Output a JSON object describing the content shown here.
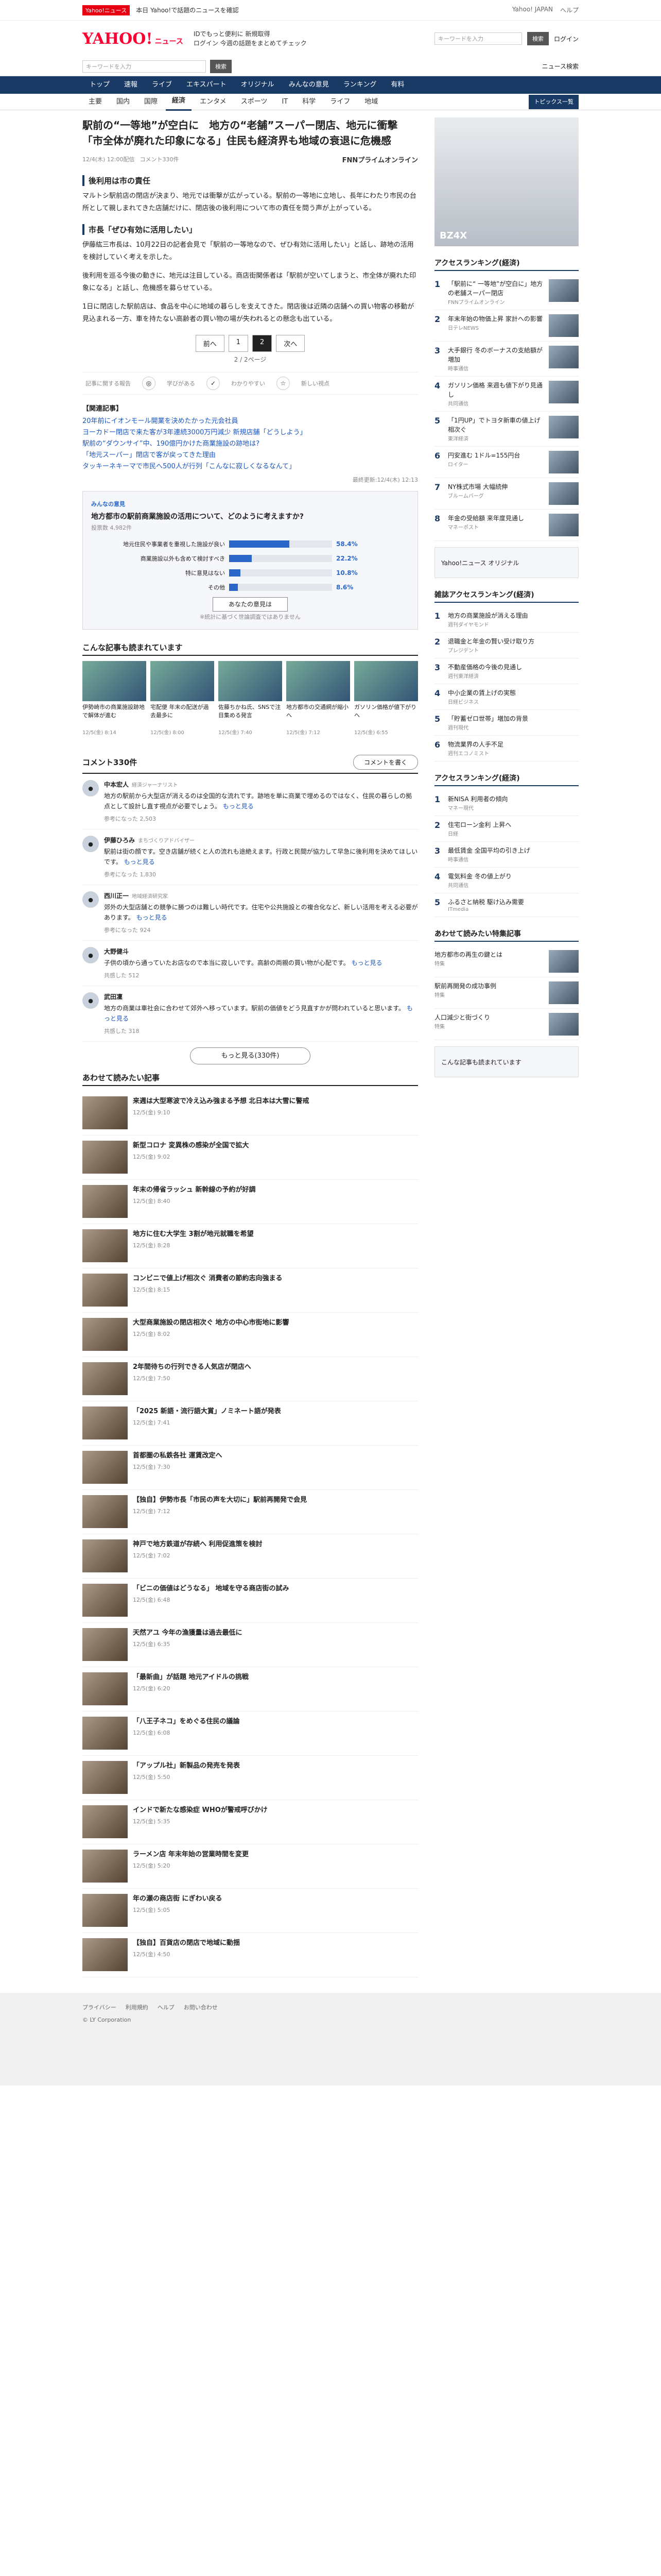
{
  "topbar": {
    "tag": "Yahoo!ニュース",
    "text": "本日 Yahoo!で話題のニュースを確認",
    "links": [
      "Yahoo! JAPAN",
      "ヘルプ"
    ]
  },
  "header": {
    "brand": "YAHOO!",
    "brand_sub": "ニュース",
    "line1": "IDでもっと便利に 新規取得",
    "line2": "ログイン 今週の話題をまとめてチェック",
    "search_placeholder": "キーワードを入力",
    "search_button": "検索",
    "login": "ログイン"
  },
  "search": {
    "placeholder": "キーワードを入力",
    "button": "検索",
    "right": "ニュース検索"
  },
  "nav": [
    "トップ",
    "速報",
    "ライブ",
    "エキスパート",
    "オリジナル",
    "みんなの意見",
    "ランキング",
    "有料"
  ],
  "subnav": {
    "items": [
      "主要",
      "国内",
      "国際",
      "経済",
      "エンタメ",
      "スポーツ",
      "IT",
      "科学",
      "ライフ",
      "地域"
    ],
    "active": "経済",
    "topics": "トピックス一覧"
  },
  "article": {
    "title": "駅前の“一等地”が空白に　地方の“老舗”スーパー閉店、地元に衝撃「市全体が廃れた印象になる」住民も経済界も地域の衰退に危機感",
    "date": "12/4(木) 12:00配信",
    "comments": "コメント330件",
    "source": "FNNプライムオンライン",
    "h_1": "後利用は市の責任",
    "p_1": "マルトシ駅前店の閉店が決まり、地元では衝撃が広がっている。駅前の一等地に立地し、長年にわたり市民の台所として親しまれてきた店舗だけに、閉店後の後利用について市の責任を問う声が上がっている。",
    "h_2": "市長「ぜひ有効に活用したい」",
    "p_2": "伊藤紘三市長は、10月22日の記者会見で「駅前の一等地なので、ぜひ有効に活用したい」と話し、跡地の活用を検討していく考えを示した。",
    "p_3": "後利用を巡る今後の動きに、地元は注目している。商店街関係者は「駅前が空いてしまうと、市全体が廃れた印象になる」と話し、危機感を募らせている。",
    "p_4": "1日に閉店した駅前店は、食品を中心に地域の暮らしを支えてきた。閉店後は近隣の店舗への買い物客の移動が見込まれる一方、車を持たない高齢者の買い物の場が失われるとの懸念も出ている。",
    "pager": {
      "prev": "前へ",
      "pages": [
        "1",
        "2"
      ],
      "current": "2",
      "next": "次へ",
      "info": "2 / 2ページ"
    },
    "toolbar": {
      "label": "記事に関する報告",
      "items": [
        "学びがある",
        "わかりやすい",
        "新しい視点"
      ]
    },
    "related": {
      "head": "【関連記事】",
      "links": [
        "20年前にイオンモール開業を決めたかった元会社員",
        "ヨーカドー閉店で来た客が3年連続3000万円減少 新規店舗「どうしよう」",
        "駅前の“ダウンサイ”中、190億円かけた商業施設の跡地は?",
        "「地元スーパー」閉店で客が戻ってきた理由",
        "タッキーネキーマで市民へ500人が行列「こんなに寂しくなるなんて」"
      ]
    },
    "updated": "最終更新:12/4(木) 12:13"
  },
  "survey": {
    "badge": "みんなの意見",
    "question": "地方都市の駅前商業施設の活用について、どのように考えますか?",
    "count": "投票数 4,982件",
    "options": [
      {
        "label": "地元住民や事業者を重視した施設が良い",
        "pct": "58.4%"
      },
      {
        "label": "商業施設以外も含めて検討すべき",
        "pct": "22.2%"
      },
      {
        "label": "特に意見はない",
        "pct": "10.8%"
      },
      {
        "label": "その他",
        "pct": "8.6%"
      }
    ],
    "vote": "あなたの意見は",
    "note": "※統計に基づく世論調査ではありません"
  },
  "recommend": {
    "head": "こんな記事も読まれています",
    "cards": [
      {
        "t": "伊勢崎市の商業施設跡地で解体が進む",
        "d": "12/5(金) 8:14"
      },
      {
        "t": "宅配便 年末の配送が過去最多に",
        "d": "12/5(金) 8:00"
      },
      {
        "t": "佐藤ちかね氏、SNSで注目集める発言",
        "d": "12/5(金) 7:40"
      },
      {
        "t": "地方都市の交通網が縮小へ",
        "d": "12/5(金) 7:12"
      },
      {
        "t": "ガソリン価格が値下がりへ",
        "d": "12/5(金) 6:55"
      }
    ]
  },
  "comments": {
    "title": "コメント330件",
    "button": "コメントを書く",
    "items": [
      {
        "name": "中本宏人",
        "role": "経済ジャーナリスト",
        "text": "地方の駅前から大型店が消えるのは全国的な流れです。跡地を単に商業で埋めるのではなく、住民の暮らしの拠点として設計し直す視点が必要でしょう。",
        "more": "もっと見る",
        "likes": "参考になった 2,503"
      },
      {
        "name": "伊藤ひろみ",
        "role": "まちづくりアドバイザー",
        "text": "駅前は街の顔です。空き店舗が続くと人の流れも途絶えます。行政と民間が協力して早急に後利用を決めてほしいです。",
        "more": "もっと見る",
        "likes": "参考になった 1,830"
      },
      {
        "name": "西川正一",
        "role": "地域経済研究家",
        "text": "郊外の大型店舗との競争に勝つのは難しい時代です。住宅や公共施設との複合化など、新しい活用を考える必要があります。",
        "more": "もっと見る",
        "likes": "参考になった 924"
      },
      {
        "name": "大野健斗",
        "role": "",
        "text": "子供の頃から通っていたお店なので本当に寂しいです。高齢の両親の買い物が心配です。",
        "more": "もっと見る",
        "likes": "共感した 512"
      },
      {
        "name": "武田凜",
        "role": "",
        "text": "地方の商業は車社会に合わせて郊外へ移っています。駅前の価値をどう見直すかが問われていると思います。",
        "more": "もっと見る",
        "likes": "共感した 318"
      }
    ],
    "more": "もっと見る(330件)"
  },
  "also": {
    "head": "あわせて読みたい記事",
    "items": [
      {
        "t": "来週は大型寒波で冷え込み強まる予想 北日本は大雪に警戒",
        "d": "12/5(金) 9:10"
      },
      {
        "t": "新型コロナ 変異株の感染が全国で拡大",
        "d": "12/5(金) 9:02"
      },
      {
        "t": "年末の帰省ラッシュ 新幹線の予約が好調",
        "d": "12/5(金) 8:40"
      },
      {
        "t": "地方に住む大学生 3割が地元就職を希望",
        "d": "12/5(金) 8:28"
      },
      {
        "t": "コンビニで値上げ相次ぐ 消費者の節約志向強まる",
        "d": "12/5(金) 8:15"
      },
      {
        "t": "大型商業施設の閉店相次ぐ 地方の中心市街地に影響",
        "d": "12/5(金) 8:02"
      },
      {
        "t": "2年間待ちの行列できる人気店が閉店へ",
        "d": "12/5(金) 7:50"
      },
      {
        "t": "「2025 新語・流行語大賞」ノミネート語が発表",
        "d": "12/5(金) 7:41"
      },
      {
        "t": "首都圏の私鉄各社 運賃改定へ",
        "d": "12/5(金) 7:30"
      },
      {
        "t": "【独自】伊勢市長「市民の声を大切に」駅前再開発で会見",
        "d": "12/5(金) 7:12"
      },
      {
        "t": "神戸で地方鉄道が存続へ 利用促進策を検討",
        "d": "12/5(金) 7:02"
      },
      {
        "t": "「ビニの価値はどうなる」 地域を守る商店街の試み",
        "d": "12/5(金) 6:48"
      },
      {
        "t": "天然アユ 今年の漁獲量は過去最低に",
        "d": "12/5(金) 6:35"
      },
      {
        "t": "「最新曲」が話題 地元アイドルの挑戦",
        "d": "12/5(金) 6:20"
      },
      {
        "t": "「八王子ネコ」をめぐる住民の議論",
        "d": "12/5(金) 6:08"
      },
      {
        "t": "「アップル社」新製品の発売を発表",
        "d": "12/5(金) 5:50"
      },
      {
        "t": "インドで新たな感染症 WHOが警戒呼びかけ",
        "d": "12/5(金) 5:35"
      },
      {
        "t": "ラーメン店 年末年始の営業時間を変更",
        "d": "12/5(金) 5:20"
      },
      {
        "t": "年の瀬の商店街 にぎわい戻る",
        "d": "12/5(金) 5:05"
      },
      {
        "t": "【独自】百貨店の閉店で地域に動揺",
        "d": "12/5(金) 4:50"
      }
    ]
  },
  "side": {
    "ad_text": "BZ4X",
    "rank1": {
      "head": "アクセスランキング(経済)",
      "items": [
        {
          "t": "「駅前に“ 一等地”が空白に」地方の老舗スーパー閉店",
          "s": "FNNプライムオンライン"
        },
        {
          "t": "年末年始の物価上昇 家計への影響",
          "s": "日テレNEWS"
        },
        {
          "t": "大手銀行 冬のボーナスの支給額が増加",
          "s": "時事通信"
        },
        {
          "t": "ガソリン価格 来週も値下がり見通し",
          "s": "共同通信"
        },
        {
          "t": "「1円UP」でトヨタ新車の値上げ相次ぐ",
          "s": "東洋経済"
        },
        {
          "t": "円安進む 1ドル=155円台",
          "s": "ロイター"
        },
        {
          "t": "NY株式市場 大幅続伸",
          "s": "ブルームバーグ"
        },
        {
          "t": "年金の受給額 来年度見通し",
          "s": "マネーポスト"
        }
      ]
    },
    "banner1": "Yahoo!ニュース オリジナル",
    "rank2": {
      "head": "雑誌アクセスランキング(経済)",
      "items": [
        {
          "t": "地方の商業施設が消える理由",
          "s": "週刊ダイヤモンド"
        },
        {
          "t": "退職金と年金の賢い受け取り方",
          "s": "プレジデント"
        },
        {
          "t": "不動産価格の今後の見通し",
          "s": "週刊東洋経済"
        },
        {
          "t": "中小企業の賃上げの実態",
          "s": "日経ビジネス"
        },
        {
          "t": "「貯蓄ゼロ世帯」増加の背景",
          "s": "週刊現代"
        },
        {
          "t": "物流業界の人手不足",
          "s": "週刊エコノミスト"
        }
      ]
    },
    "rank3": {
      "head": "アクセスランキング(経済)",
      "items": [
        {
          "t": "新NISA 利用者の傾向",
          "s": "マネー現代"
        },
        {
          "t": "住宅ローン金利 上昇へ",
          "s": "日経"
        },
        {
          "t": "最低賃金 全国平均の引き上げ",
          "s": "時事通信"
        },
        {
          "t": "電気料金 冬の値上がり",
          "s": "共同通信"
        },
        {
          "t": "ふるさと納税 駆け込み需要",
          "s": "ITmedia"
        }
      ]
    },
    "rank4": {
      "head": "あわせて読みたい特集記事",
      "items": [
        {
          "t": "地方都市の再生の鍵とは",
          "s": "特集"
        },
        {
          "t": "駅前再開発の成功事例",
          "s": "特集"
        },
        {
          "t": "人口減少と街づくり",
          "s": "特集"
        }
      ]
    },
    "banner2": "こんな記事も読まれています"
  },
  "footer": {
    "text": "© LY Corporation",
    "links": [
      "プライバシー",
      "利用規約",
      "ヘルプ",
      "お問い合わせ"
    ]
  }
}
